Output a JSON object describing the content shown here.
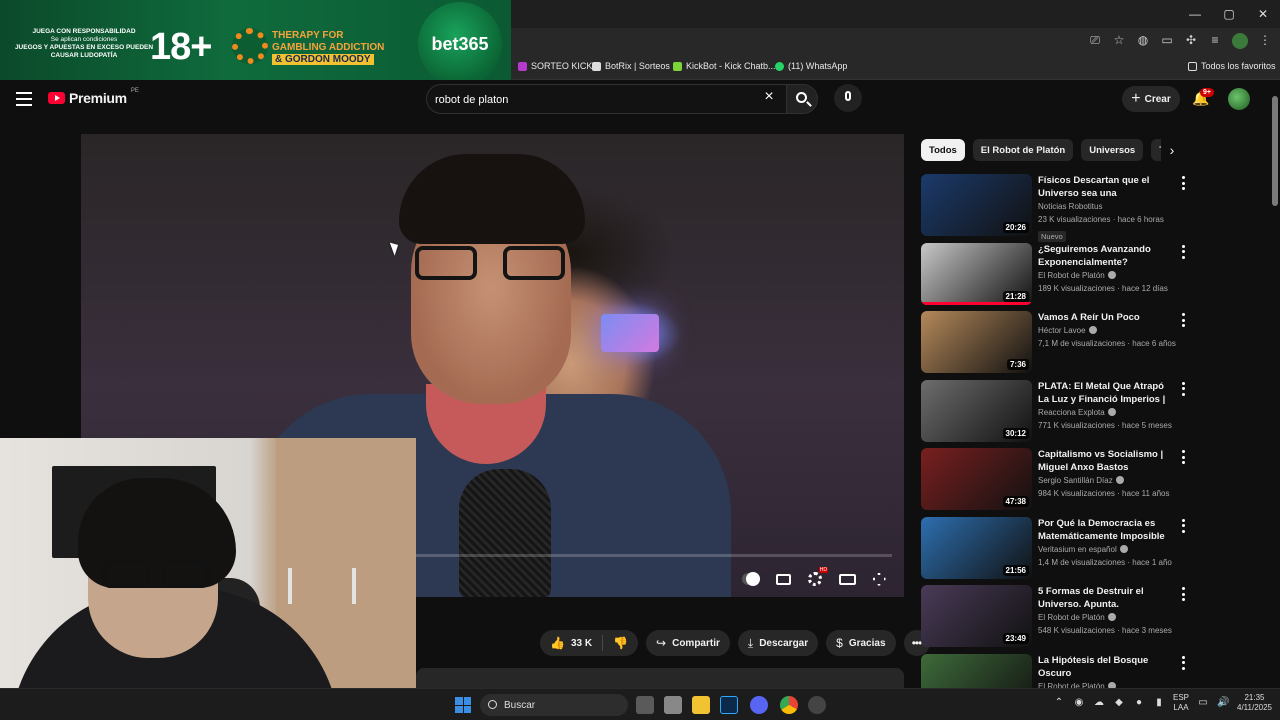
{
  "browser": {
    "window_controls": [
      "—",
      "▢",
      "✕"
    ],
    "bookmarks": [
      {
        "label": "SORTEO KICK",
        "color": "#b43ac9"
      },
      {
        "label": "BotRix | Sorteos",
        "color": "#dddddd"
      },
      {
        "label": "KickBot - Kick Chatb...",
        "color": "#7bd43a"
      },
      {
        "label": "(11) WhatsApp",
        "color": "#25d366"
      }
    ],
    "all_favorites": "Todos los favoritos"
  },
  "ad": {
    "line1": "JUEGA CON RESPONSABILIDAD",
    "line2": "Se aplican condiciones",
    "line3": "JUEGOS Y APUESTAS EN EXCESO PUEDEN CAUSAR LUDOPATÍA",
    "age": "18+",
    "therapy": "THERAPY FOR GAMBLING ADDICTION",
    "gordon": "& GORDON MOODY",
    "brand": "bet365"
  },
  "header": {
    "logo_text": "Premium",
    "logo_country": "PE",
    "search_query": "robot de platon",
    "create_label": "Crear",
    "notifications_badge": "9+"
  },
  "video": {
    "progress_fraction": 0.0
  },
  "actions": {
    "likes": "33 K",
    "share": "Compartir",
    "download": "Descargar",
    "thanks": "Gracias"
  },
  "chips": [
    "Todos",
    "El Robot de Platón",
    "Universos",
    "Tec"
  ],
  "related": [
    {
      "title": "Físicos Descartan que el Universo sea una Simulación",
      "channel": "Noticias Robotitus",
      "verified": false,
      "meta": "23 K visualizaciones · hace 6 horas",
      "badge": "Nuevo",
      "duration": "20:26",
      "thumb_bg": "#1b3a6b",
      "watched": 0
    },
    {
      "title": "¿Seguiremos Avanzando Exponencialmente?",
      "channel": "El Robot de Platón",
      "verified": true,
      "meta": "189 K visualizaciones · hace 12 días",
      "badge": "",
      "duration": "21:28",
      "thumb_bg": "#c8c8c8",
      "watched": 1
    },
    {
      "title": "Vamos A Reír Un Poco",
      "channel": "Héctor Lavoe",
      "verified": true,
      "meta": "7,1 M de visualizaciones · hace 6 años",
      "badge": "",
      "duration": "7:36",
      "thumb_bg": "#b5895a",
      "watched": 0
    },
    {
      "title": "PLATA: El Metal Que Atrapó La Luz y Financió Imperios | ...",
      "channel": "Reacciona Explota",
      "verified": true,
      "meta": "771 K visualizaciones · hace 5 meses",
      "badge": "",
      "duration": "30:12",
      "thumb_bg": "#6d6d6d",
      "watched": 0
    },
    {
      "title": "Capitalismo vs Socialismo | Miguel Anxo Bastos",
      "channel": "Sergio Santillán Díaz",
      "verified": true,
      "meta": "984 K visualizaciones · hace 11 años",
      "badge": "",
      "duration": "47:38",
      "thumb_bg": "#7a1f1f",
      "watched": 0
    },
    {
      "title": "Por Qué la Democracia es Matemáticamente Imposible",
      "channel": "Veritasium en español",
      "verified": true,
      "meta": "1,4 M de visualizaciones · hace 1 año",
      "badge": "",
      "duration": "21:56",
      "thumb_bg": "#2d6fb0",
      "watched": 0
    },
    {
      "title": "5 Formas de Destruir el Universo. Apunta.",
      "channel": "El Robot de Platón",
      "verified": true,
      "meta": "548 K visualizaciones · hace 3 meses",
      "badge": "",
      "duration": "23:49",
      "thumb_bg": "#4a3b58",
      "watched": 0
    },
    {
      "title": "La Hipótesis del Bosque Oscuro",
      "channel": "El Robot de Platón",
      "verified": true,
      "meta": "",
      "badge": "",
      "duration": "",
      "thumb_bg": "#3e6b3a",
      "watched": 0
    }
  ],
  "taskbar": {
    "search_placeholder": "Buscar",
    "lang": "ESP",
    "lang2": "LAA",
    "time": "21:35",
    "date": "4/11/2025"
  }
}
